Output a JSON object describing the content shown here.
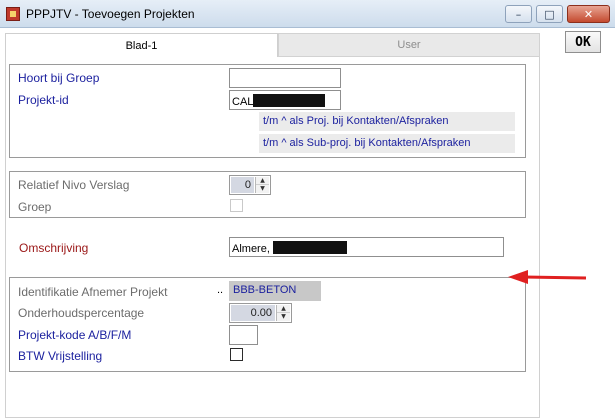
{
  "window": {
    "title": "PPPJTV - Toevoegen Projekten",
    "min_glyph": "–",
    "max_glyph": "□",
    "close_glyph": "✕"
  },
  "toolbar": {
    "ok_label": "OK"
  },
  "tabs": [
    {
      "label": "Blad-1",
      "active": true
    },
    {
      "label": "User",
      "active": false
    }
  ],
  "group1": {
    "hoort_bij_groep_label": "Hoort bij Groep",
    "hoort_bij_groep_value": "",
    "projekt_id_label": "Projekt-id",
    "projekt_id_value": "CAL",
    "note1": "t/m     ^  als Proj. bij Kontakten/Afspraken",
    "note2": "t/m ^ als Sub-proj. bij Kontakten/Afspraken"
  },
  "group2": {
    "relatief_label": "Relatief Nivo Verslag",
    "relatief_value": "0",
    "groep_label": "Groep",
    "groep_checked": false
  },
  "omschrijving": {
    "label": "Omschrijving",
    "value": "Almere, "
  },
  "group3": {
    "identificatie_label": "Identifikatie Afnemer Projekt",
    "identificatie_dots": "..",
    "identificatie_value": "BBB-BETON",
    "onderhoud_label": "Onderhoudspercentage",
    "onderhoud_value": "0.00",
    "projekt_kode_label": "Projekt-kode A/B/F/M",
    "projekt_kode_value": "",
    "btw_label": "BTW Vrijstelling",
    "btw_checked": false
  },
  "spin_glyphs": {
    "up": "▲",
    "down": "▼"
  },
  "colors": {
    "label_blue": "#1a1f9e",
    "label_red": "#9a1616",
    "label_grey": "#6c6c6c",
    "annotation_arrow": "#e02020"
  }
}
